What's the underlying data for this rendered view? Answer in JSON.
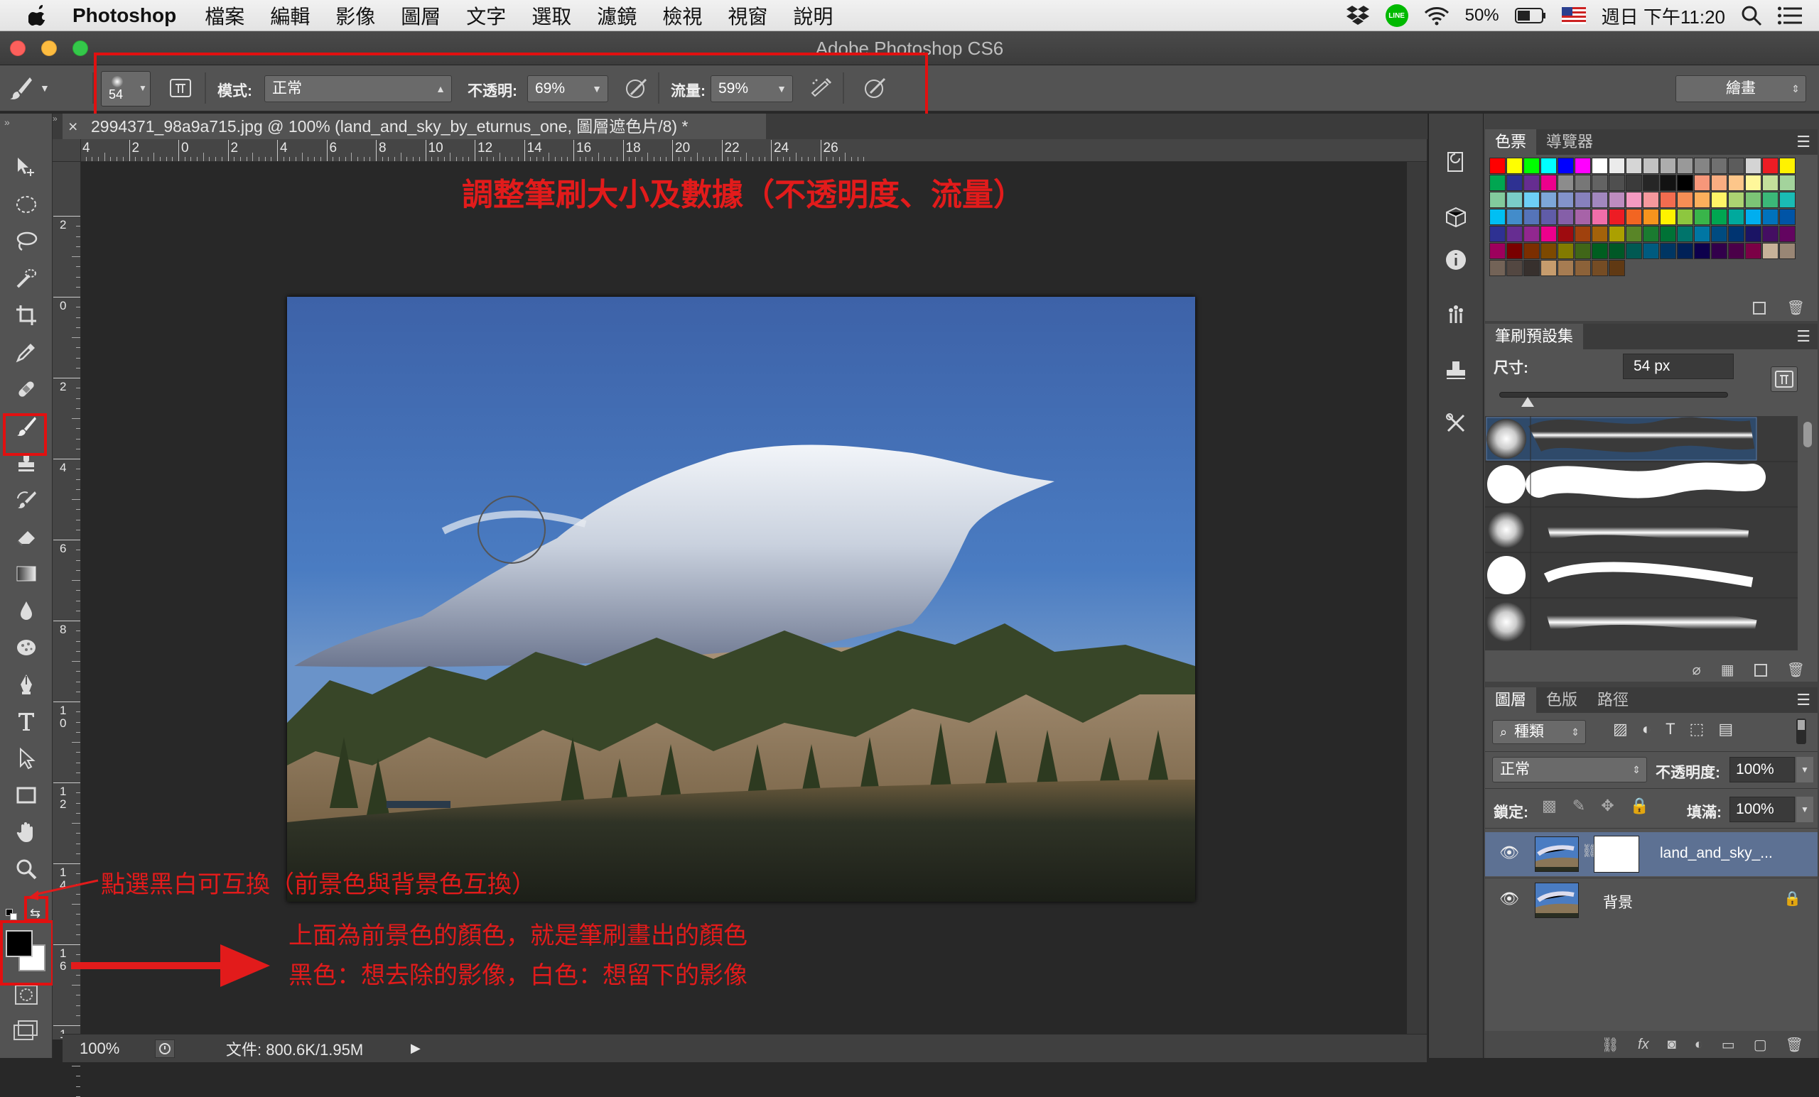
{
  "menubar": {
    "apple_icon": "apple-logo-icon",
    "app_name": "Photoshop",
    "items": [
      "檔案",
      "編輯",
      "影像",
      "圖層",
      "文字",
      "選取",
      "濾鏡",
      "檢視",
      "視窗",
      "說明"
    ],
    "battery": "50%",
    "datetime": "週日 下午11:20",
    "line_badge": "LINE"
  },
  "window": {
    "title": "Adobe Photoshop CS6"
  },
  "options_bar": {
    "brush_size": "54",
    "mode_label": "模式:",
    "mode_value": "正常",
    "opacity_label": "不透明:",
    "opacity_value": "69%",
    "flow_label": "流量:",
    "flow_value": "59%",
    "workspace": "繪畫"
  },
  "document": {
    "tab_title": "2994371_98a9a715.jpg @ 100% (land_and_sky_by_eturnus_one, 圖層遮色片/8) *",
    "close_glyph": "×",
    "zoom": "100%",
    "file_info": "文件: 800.6K/1.95M"
  },
  "rulers": {
    "h_labels": [
      "4",
      "2",
      "0",
      "2",
      "4",
      "6",
      "8",
      "10",
      "12",
      "14",
      "16",
      "18",
      "20",
      "22",
      "24",
      "26"
    ],
    "v_labels": [
      "2",
      "0",
      "2",
      "4",
      "6",
      "8",
      "1\n0",
      "1\n2",
      "1\n4",
      "1\n6",
      "1"
    ]
  },
  "annotations": {
    "top": "調整筆刷大小及數據（不透明度、流量）",
    "swap": "點選黑白可互換（前景色與背景色互換）",
    "fg_line1": "上面為前景色的顏色，就是筆刷畫出的顏色",
    "fg_line2": "黑色：想去除的影像，白色：想留下的影像"
  },
  "swatches_panel": {
    "tabs": [
      "色票",
      "導覽器"
    ],
    "colors": [
      "#ff0000",
      "#ffff00",
      "#00ff00",
      "#00ffff",
      "#0000ff",
      "#ff00ff",
      "#ffffff",
      "#ebebeb",
      "#d6d6d6",
      "#c2c2c2",
      "#adadad",
      "#999999",
      "#858585",
      "#707070",
      "#5c5c5c",
      "#d4d4d4",
      "#ec1c24",
      "#fff200",
      "#00a651",
      "#2e3192",
      "#662d91",
      "#ec008c",
      "#8c8c8c",
      "#777777",
      "#636363",
      "#4f4f4f",
      "#3b3b3b",
      "#262626",
      "#121212",
      "#000000",
      "#f7977a",
      "#f9ad81",
      "#fdc68a",
      "#fff79a",
      "#c4df9b",
      "#a3d39c",
      "#82ca9d",
      "#7accc8",
      "#6dcff6",
      "#7da7d9",
      "#8393ca",
      "#8781bd",
      "#a187be",
      "#bd8cbf",
      "#f49ac1",
      "#f6989d",
      "#f26c4f",
      "#f68e55",
      "#fbaf5c",
      "#fff467",
      "#acd372",
      "#7cc576",
      "#3bb878",
      "#1abbb4",
      "#00bff3",
      "#438cca",
      "#5574b9",
      "#605ca8",
      "#855fa8",
      "#a763a8",
      "#f06ea9",
      "#ed1c24",
      "#f26522",
      "#f7941d",
      "#fff200",
      "#8dc73f",
      "#39b54a",
      "#00a651",
      "#00a99d",
      "#00aeef",
      "#0072bc",
      "#0054a6",
      "#2e3192",
      "#662d91",
      "#92278f",
      "#ec008c",
      "#9e0b0f",
      "#a0410d",
      "#a3620a",
      "#aba000",
      "#598527",
      "#1a7b30",
      "#007236",
      "#00746b",
      "#0076a3",
      "#004b80",
      "#003471",
      "#1b1464",
      "#440e62",
      "#630460",
      "#9e005d",
      "#790000",
      "#7b2e00",
      "#7d4900",
      "#827b00",
      "#406618",
      "#005e20",
      "#005826",
      "#005952",
      "#005b7f",
      "#003663",
      "#002157",
      "#0d004c",
      "#32004b",
      "#4b0049",
      "#7b0046",
      "#c7b299",
      "#998675",
      "#736357",
      "#534741",
      "#37302d",
      "#c69c6d",
      "#a67c52",
      "#8c6239",
      "#754c24",
      "#603913"
    ]
  },
  "brush_presets_panel": {
    "tab": "筆刷預設集",
    "size_label": "尺寸:",
    "size_value": "54 px",
    "slider_level": 0.12
  },
  "layers_panel": {
    "tabs": [
      "圖層",
      "色版",
      "路徑"
    ],
    "filter_label": "種類",
    "blend_mode": "正常",
    "opacity_label": "不透明度:",
    "opacity_value": "100%",
    "lock_label": "鎖定:",
    "fill_label": "填滿:",
    "fill_value": "100%",
    "layers": [
      {
        "name": "land_and_sky_...",
        "selected": true
      },
      {
        "name": "背景",
        "selected": false
      }
    ]
  }
}
